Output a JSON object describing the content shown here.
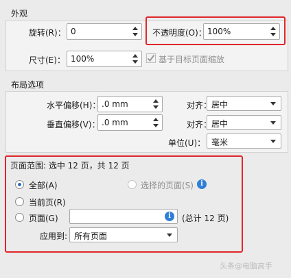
{
  "appearance": {
    "title": "外观",
    "rotation_label": "旋转(R)：",
    "rotation_value": "0",
    "opacity_label": "不透明度(O)：",
    "opacity_value": "100%",
    "size_label": "尺寸(E)：",
    "size_value": "100%",
    "scale_checkbox_label": "基于目标页面缩放",
    "scale_checked": true
  },
  "layout": {
    "title": "布局选项",
    "h_offset_label": "水平偏移(H)：",
    "h_offset_value": ".0 mm",
    "v_offset_label": "垂直偏移(V)：",
    "v_offset_value": ".0 mm",
    "align_label_1": "对齐：",
    "align_value_1": "居中",
    "align_label_2": "对齐：",
    "align_value_2": "居中",
    "unit_label": "单位(U)：",
    "unit_value": "毫米"
  },
  "page_range": {
    "title": "页面范围: 选中 12 页，共 12 页",
    "all_label": "全部(A)",
    "selected_label": "选择的页面(S)",
    "current_label": "当前页(R)",
    "pages_label": "页面(G)",
    "pages_value": "",
    "total_label": "(总计 12 页)",
    "apply_label": "应用到:",
    "apply_value": "所有页面",
    "selected_option": "all"
  },
  "watermark": "头条@电脑高手"
}
